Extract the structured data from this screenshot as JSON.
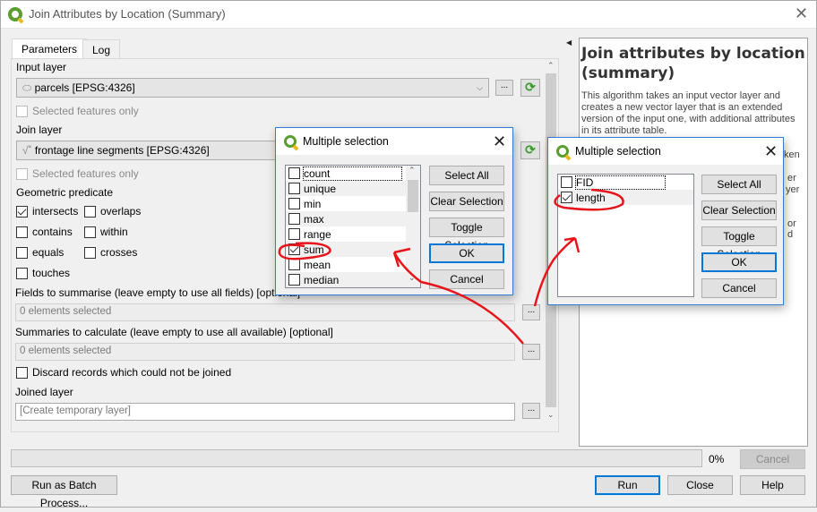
{
  "window": {
    "title": "Join Attributes by Location (Summary)",
    "close_icon": "close-x"
  },
  "tabs": [
    {
      "label": "Parameters",
      "active": true
    },
    {
      "label": "Log",
      "active": false
    }
  ],
  "params": {
    "input_layer_label": "Input layer",
    "input_layer_value": "parcels [EPSG:4326]",
    "input_selected_only": "Selected features only",
    "join_layer_label": "Join layer",
    "join_layer_value": "frontage line segments [EPSG:4326]",
    "join_selected_only": "Selected features only",
    "predicate_label": "Geometric predicate",
    "predicates": [
      {
        "label": "intersects",
        "checked": true
      },
      {
        "label": "overlaps",
        "checked": false
      },
      {
        "label": "contains",
        "checked": false
      },
      {
        "label": "within",
        "checked": false
      },
      {
        "label": "equals",
        "checked": false
      },
      {
        "label": "crosses",
        "checked": false
      },
      {
        "label": "touches",
        "checked": false
      }
    ],
    "fields_label": "Fields to summarise (leave empty to use all fields) [optional]",
    "fields_value": "0 elements selected",
    "summaries_label": "Summaries to calculate (leave empty to use all available) [optional]",
    "summaries_value": "0 elements selected",
    "discard_label": "Discard records which could not be joined",
    "joined_layer_label": "Joined layer",
    "joined_layer_placeholder": "[Create temporary layer]",
    "dots": "...",
    "dropdown_arrow": "⌵",
    "refresh_icon": "⟳"
  },
  "help": {
    "title": "Join attributes by location (summary)",
    "text": "This algorithm takes an input vector layer and creates a new vector layer that is an extended version of the input one, with additional attributes in its attribute table.",
    "partial_lines": [
      "ken",
      "er",
      "yer",
      "or",
      "d"
    ]
  },
  "progress": {
    "value_percent": 0,
    "label": "0%"
  },
  "footer": {
    "cancel": "Cancel",
    "batch": "Run as Batch Process...",
    "run": "Run",
    "close": "Close",
    "help": "Help"
  },
  "dialog_summaries": {
    "title": "Multiple selection",
    "items": [
      {
        "label": "count",
        "checked": false
      },
      {
        "label": "unique",
        "checked": false
      },
      {
        "label": "min",
        "checked": false
      },
      {
        "label": "max",
        "checked": false
      },
      {
        "label": "range",
        "checked": false
      },
      {
        "label": "sum",
        "checked": true
      },
      {
        "label": "mean",
        "checked": false
      },
      {
        "label": "median",
        "checked": false
      }
    ],
    "buttons": {
      "select_all": "Select All",
      "clear": "Clear Selection",
      "toggle": "Toggle Selection",
      "ok": "OK",
      "cancel": "Cancel"
    }
  },
  "dialog_fields": {
    "title": "Multiple selection",
    "items": [
      {
        "label": "FID",
        "checked": false
      },
      {
        "label": "length",
        "checked": true
      }
    ],
    "buttons": {
      "select_all": "Select All",
      "clear": "Clear Selection",
      "toggle": "Toggle Selection",
      "ok": "OK",
      "cancel": "Cancel"
    }
  },
  "annotation_color": "#e8141b"
}
